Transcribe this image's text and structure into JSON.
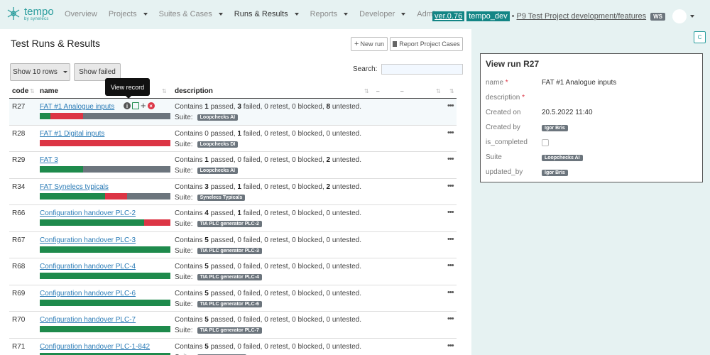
{
  "brand": {
    "name": "tempo",
    "sub": "by synelecs"
  },
  "nav": [
    {
      "label": "Overview",
      "caret": false
    },
    {
      "label": "Projects",
      "caret": true
    },
    {
      "label": "Suites & Cases",
      "caret": true
    },
    {
      "label": "Runs & Results",
      "caret": true,
      "active": true
    },
    {
      "label": "Reports",
      "caret": true
    },
    {
      "label": "Developer",
      "caret": true
    },
    {
      "label": "Admin",
      "caret": false
    }
  ],
  "context": {
    "version": "ver.0.76",
    "env": "tempo_dev",
    "separator": "•",
    "project": "P9 Test Project development/features",
    "ws": "WS"
  },
  "page": {
    "title": "Test Runs & Results",
    "new_run": "New run",
    "report_cases": "Report Project Cases",
    "show_rows": "Show 10 rows",
    "show_failed": "Show failed",
    "search_label": "Search:",
    "tooltip": "View record"
  },
  "columns": {
    "code": "code",
    "name": "name",
    "description": "description"
  },
  "rows": [
    {
      "code": "R27",
      "name": "FAT #1 Analogue inputs",
      "passed": 1,
      "failed": 3,
      "retest": 0,
      "blocked": 0,
      "untested": 8,
      "suite": "Loopchecks AI",
      "bold": [
        "passed",
        "failed",
        "untested"
      ]
    },
    {
      "code": "R28",
      "name": "FAT #1 Digital inputs",
      "passed": 0,
      "failed": 1,
      "retest": 0,
      "blocked": 0,
      "untested": 0,
      "suite": "Loopchecks DI",
      "bold": [
        "failed"
      ]
    },
    {
      "code": "R29",
      "name": "FAT 3",
      "passed": 1,
      "failed": 0,
      "retest": 0,
      "blocked": 0,
      "untested": 2,
      "suite": "Loopchecks AI",
      "bold": [
        "passed",
        "untested"
      ]
    },
    {
      "code": "R34",
      "name": "FAT Synelecs typicals",
      "passed": 3,
      "failed": 1,
      "retest": 0,
      "blocked": 0,
      "untested": 2,
      "suite": "Synelecs Typicals",
      "bold": [
        "passed",
        "failed",
        "untested"
      ]
    },
    {
      "code": "R66",
      "name": "Configuration handover PLC-2",
      "passed": 4,
      "failed": 1,
      "retest": 0,
      "blocked": 0,
      "untested": 0,
      "suite": "TIA PLC generator PLC-2",
      "bold": [
        "passed",
        "failed"
      ]
    },
    {
      "code": "R67",
      "name": "Configuration handover PLC-3",
      "passed": 5,
      "failed": 0,
      "retest": 0,
      "blocked": 0,
      "untested": 0,
      "suite": "TIA PLC generator PLC-3",
      "bold": [
        "passed"
      ]
    },
    {
      "code": "R68",
      "name": "Configuration handover PLC-4",
      "passed": 5,
      "failed": 0,
      "retest": 0,
      "blocked": 0,
      "untested": 0,
      "suite": "TIA PLC generator PLC-4",
      "bold": [
        "passed"
      ]
    },
    {
      "code": "R69",
      "name": "Configuration handover PLC-6",
      "passed": 5,
      "failed": 0,
      "retest": 0,
      "blocked": 0,
      "untested": 0,
      "suite": "TIA PLC generator PLC-6",
      "bold": [
        "passed"
      ]
    },
    {
      "code": "R70",
      "name": "Configuration handover PLC-7",
      "passed": 5,
      "failed": 0,
      "retest": 0,
      "blocked": 0,
      "untested": 0,
      "suite": "TIA PLC generator PLC-7",
      "bold": [
        "passed"
      ]
    },
    {
      "code": "R71",
      "name": "Configuration handover PLC-1-842",
      "passed": 5,
      "failed": 0,
      "retest": 0,
      "blocked": 0,
      "untested": 0,
      "suite": "TIA PLC generator",
      "bold": [
        "passed"
      ]
    }
  ],
  "strings": {
    "contains": "Contains",
    "passed": "passed",
    "failed": "failed",
    "retest": "retest",
    "blocked": "blocked",
    "untested": "untested",
    "suite_label": "Suite:"
  },
  "detail": {
    "corner_button": "C",
    "title": "View run R27",
    "fields": [
      {
        "label": "name",
        "required": true,
        "value": "FAT #1 Analogue inputs",
        "type": "text"
      },
      {
        "label": "description",
        "required": true,
        "value": "",
        "type": "text"
      },
      {
        "label": "Created on",
        "required": false,
        "value": "20.5.2022 11:40",
        "type": "text"
      },
      {
        "label": "Created by",
        "required": false,
        "value": "Igor Bris",
        "type": "badge"
      },
      {
        "label": "is_completed",
        "required": false,
        "value": "",
        "type": "checkbox"
      },
      {
        "label": "Suite",
        "required": false,
        "value": "Loopchecks AI",
        "type": "badge"
      },
      {
        "label": "updated_by",
        "required": false,
        "value": "Igor Bris",
        "type": "badge"
      }
    ]
  },
  "colors": {
    "brand": "#2a9d9d",
    "teal_dark": "#138585",
    "passed": "#1e8a4c",
    "failed": "#dc3545",
    "untested": "#6c757d",
    "link": "#2a7bb6"
  }
}
